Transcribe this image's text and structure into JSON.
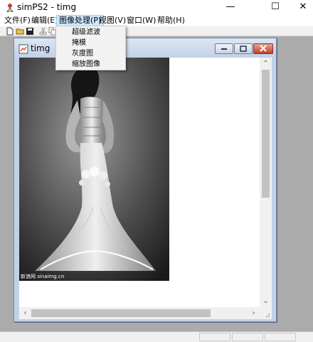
{
  "app": {
    "title": "simPS2 - timg",
    "min_glyph": "—",
    "max_glyph": "☐",
    "close_glyph": "✕"
  },
  "menubar": {
    "items": [
      {
        "label": "文件(F)"
      },
      {
        "label": "编辑(E)"
      },
      {
        "label": "图像处理(P)"
      },
      {
        "label": "视图(V)"
      },
      {
        "label": "窗口(W)"
      },
      {
        "label": "帮助(H)"
      }
    ]
  },
  "toolbar": {
    "icons": [
      "new-file-icon",
      "open-folder-icon",
      "save-disk-icon",
      "cut-scissors-icon",
      "copy-icon"
    ]
  },
  "dropdown": {
    "items": [
      {
        "label": "超级滤波"
      },
      {
        "label": "掩模"
      },
      {
        "label": "灰度图"
      },
      {
        "label": "缩放图像"
      }
    ]
  },
  "child_window": {
    "title": "timg",
    "image": {
      "description": "grayscale photo of a woman in a fitted mermaid wedding gown, viewed from behind",
      "watermark": "新浪网 sinaimg.cn"
    }
  },
  "scrollbars": {
    "up": "⌃",
    "down": "⌄",
    "left": "‹",
    "right": "›"
  },
  "colors": {
    "menu_highlight": "#cce8ff",
    "workspace": "#ababab",
    "child_frame": "#c3d1e6",
    "close_red": "#c4402a"
  }
}
